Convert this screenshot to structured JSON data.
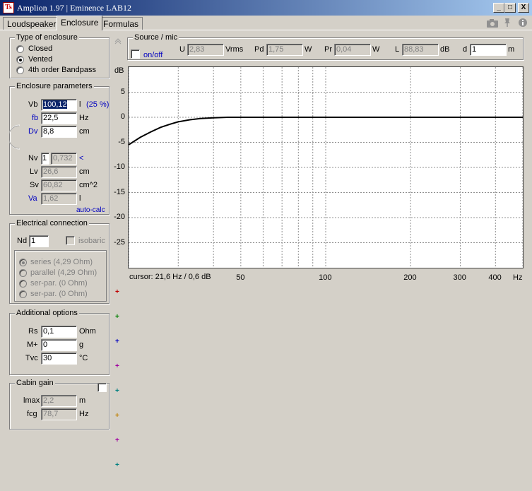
{
  "window": {
    "title": "Amplion  1.97  |  Eminence  LAB12",
    "min": "_",
    "max": "□",
    "close": "X"
  },
  "tabs": [
    "Loudspeaker",
    "Enclosure",
    "Formulas"
  ],
  "enclosure_type": {
    "title": "Type of enclosure",
    "options": [
      "Closed",
      "Vented",
      "4th order Bandpass"
    ],
    "selected": "Vented"
  },
  "params": {
    "title": "Enclosure parameters",
    "vb_label": "Vb",
    "vb_value": "100,12",
    "vb_unit": "l",
    "vb_pct": "(25 %)",
    "fb_label": "fb",
    "fb_value": "22,5",
    "fb_unit": "Hz",
    "dv_label": "Dv",
    "dv_value": "8,8",
    "dv_unit": "cm",
    "nv_label": "Nv",
    "nv_value": "1",
    "nv_ratio": "0,732",
    "nv_arrow": "<",
    "lv_label": "Lv",
    "lv_value": "26,6",
    "lv_unit": "cm",
    "sv_label": "Sv",
    "sv_value": "60,82",
    "sv_unit": "cm^2",
    "va_label": "Va",
    "va_value": "1,62",
    "va_unit": "l",
    "autocalc": "auto-calc"
  },
  "electrical": {
    "title": "Electrical connection",
    "nd_label": "Nd",
    "nd_value": "1",
    "isobaric": "isobaric",
    "options": [
      "series (4,29 Ohm)",
      "parallel (4,29 Ohm)",
      "ser-par. (0 Ohm)",
      "ser-par. (0 Ohm)"
    ],
    "selected": "series (4,29 Ohm)"
  },
  "additional": {
    "title": "Additional options",
    "rs_label": "Rs",
    "rs_value": "0,1",
    "rs_unit": "Ohm",
    "m_label": "M+",
    "m_value": "0",
    "m_unit": "g",
    "tvc_label": "Tvc",
    "tvc_value": "30",
    "tvc_unit": "°C"
  },
  "cabin": {
    "title": "Cabin gain",
    "lmax_label": "lmax",
    "lmax_value": "2,2",
    "lmax_unit": "m",
    "fcg_label": "fcg",
    "fcg_value": "78,7",
    "fcg_unit": "Hz"
  },
  "source": {
    "title": "Source / mic",
    "onoff": "on/off",
    "u_label": "U",
    "u_value": "2,83",
    "u_unit": "Vrms",
    "pd_label": "Pd",
    "pd_value": "1,75",
    "pd_unit": "W",
    "pr_label": "Pr",
    "pr_value": "0,04",
    "pr_unit": "W",
    "l_label": "L",
    "l_value": "88,83",
    "l_unit": "dB",
    "d_label": "d",
    "d_value": "1",
    "d_unit": "m"
  },
  "chart_data": {
    "type": "line",
    "ylabel": "dB",
    "xlabel": "Hz",
    "xscale": "log",
    "xlim": [
      20,
      500
    ],
    "ylim": [
      -30,
      10
    ],
    "yticks": [
      5,
      0,
      -5,
      -10,
      -15,
      -20,
      -25
    ],
    "xticks": [
      50,
      100,
      200,
      300,
      400
    ],
    "xtick_labels": [
      "50",
      "100",
      "200",
      "300",
      "400"
    ],
    "x_grid": [
      20,
      30,
      40,
      50,
      60,
      70,
      80,
      90,
      100,
      200,
      300,
      400,
      500
    ],
    "grid": true,
    "series": [
      {
        "x": [
          20,
          22,
          24,
          26,
          28,
          30,
          33,
          36,
          40,
          45,
          50,
          60,
          80,
          100,
          200,
          300,
          500
        ],
        "y": [
          -5.5,
          -4,
          -2.9,
          -2,
          -1.4,
          -0.9,
          -0.5,
          -0.25,
          -0.1,
          0,
          0,
          0,
          0,
          0,
          0,
          0,
          0
        ],
        "color": "#000000"
      }
    ],
    "cursor": "cursor: 21,6 Hz / 0,6 dB"
  },
  "plus_colors": [
    "#c00000",
    "#008000",
    "#0000c0",
    "#a000a0",
    "#008080",
    "#c08000",
    "#a000a0",
    "#008080"
  ]
}
